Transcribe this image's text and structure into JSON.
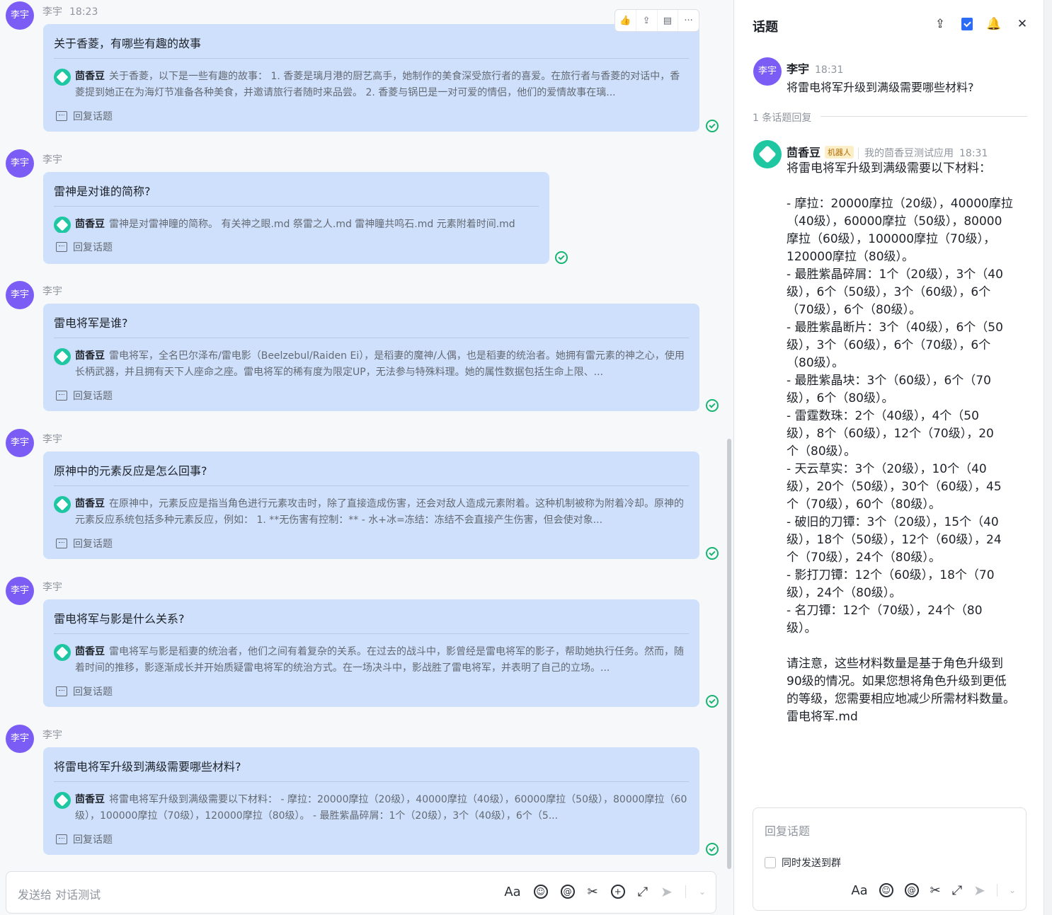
{
  "toolbar": {
    "like": "👍",
    "share": "⇪",
    "card": "▤",
    "more": "···"
  },
  "messages": [
    {
      "avatar": "李宇",
      "user": "李宇",
      "time": "18:23",
      "question": "关于香菱，有哪些有趣的故事",
      "bot": "茴香豆",
      "answer": "关于香菱，以下是一些有趣的故事： 1. 香菱是璃月港的厨艺高手，她制作的美食深受旅行者的喜爱。在旅行者与香菱的对话中，香菱提到她正在为海灯节准备各种美食，并邀请旅行者随时来品尝。 2. 香菱与锅巴是一对可爱的情侣，他们的爱情故事在璃...",
      "reply": "回复话题"
    },
    {
      "avatar": "李宇",
      "user": "李宇",
      "time": "",
      "question": "雷神是对谁的简称?",
      "bot": "茴香豆",
      "answer": "雷神是对雷神瞳的简称。 有关神之眼.md 祭雷之人.md 雷神瞳共鸣石.md 元素附着时间.md",
      "reply": "回复话题"
    },
    {
      "avatar": "李宇",
      "user": "李宇",
      "time": "",
      "question": "雷电将军是谁?",
      "bot": "茴香豆",
      "answer": "雷电将军，全名巴尔泽布/雷电影（Beelzebul/Raiden Ei），是稻妻的魔神/人偶，也是稻妻的统治者。她拥有雷元素的神之心，使用长柄武器，并且拥有天下人座命之座。雷电将军的稀有度为限定UP，无法参与特殊料理。她的属性数据包括生命上限、...",
      "reply": "回复话题"
    },
    {
      "avatar": "李宇",
      "user": "李宇",
      "time": "",
      "question": "原神中的元素反应是怎么回事?",
      "bot": "茴香豆",
      "answer": "在原神中，元素反应是指当角色进行元素攻击时，除了直接造成伤害，还会对敌人造成元素附着。这种机制被称为附着冷却。原神的元素反应系统包括多种元素反应，例如： 1. **无伤害有控制：** - 水+冰=冻结：冻结不会直接产生伤害，但会使对象...",
      "reply": "回复话题"
    },
    {
      "avatar": "李宇",
      "user": "李宇",
      "time": "",
      "question": "雷电将军与影是什么关系?",
      "bot": "茴香豆",
      "answer": "雷电将军与影是稻妻的统治者，他们之间有着复杂的关系。在过去的战斗中，影曾经是雷电将军的影子，帮助她执行任务。然而，随着时间的推移，影逐渐成长并开始质疑雷电将军的统治方式。在一场决斗中，影战胜了雷电将军，并表明了自己的立场。...",
      "reply": "回复话题"
    },
    {
      "avatar": "李宇",
      "user": "李宇",
      "time": "",
      "question": "将雷电将军升级到满级需要哪些材料?",
      "bot": "茴香豆",
      "answer": "将雷电将军升级到满级需要以下材料： - 摩拉：20000摩拉（20级），40000摩拉（40级），60000摩拉（50级），80000摩拉（60级），100000摩拉（70级），120000摩拉（80级）。 - 最胜紫晶碎屑：1个（20级），3个（40级），6个（5...",
      "reply": "回复话题"
    }
  ],
  "composer": {
    "placeholder": "发送给 对话测试",
    "font": "Aa",
    "emoji": "☺",
    "mention": "@",
    "scissors": "✂",
    "plus": "+",
    "expand": "⤢",
    "send": "➤",
    "dropdown": "⌄"
  },
  "panel": {
    "title": "话题",
    "icons": {
      "share": "⇪",
      "bell": "🔔",
      "close": "✕"
    },
    "user_avatar": "李宇",
    "user": "李宇",
    "user_time": "18:31",
    "question": "将雷电将军升级到满级需要哪些材料?",
    "reply_count": "1 条话题回复",
    "bot": "茴香豆",
    "bot_tag": "机器人",
    "bot_app": "我的茴香豆测试应用",
    "bot_time": "18:31",
    "bot_body": "将雷电将军升级到满级需要以下材料：\n\n- 摩拉：20000摩拉（20级），40000摩拉\n（40级），60000摩拉（50级），80000\n摩拉（60级），100000摩拉（70级），\n120000摩拉（80级）。\n- 最胜紫晶碎屑：1个（20级），3个（40\n级），6个（50级），3个（60级），6个\n（70级），6个（80级）。\n- 最胜紫晶断片：3个（40级），6个（50\n级），3个（60级），6个（70级），6个\n（80级）。\n- 最胜紫晶块：3个（60级），6个（70\n级），6个（80级）。\n- 雷霆数珠：2个（40级），4个（50\n级），8个（60级），12个（70级），20\n个（80级）。\n- 天云草实：3个（20级），10个（40\n级），20个（50级），30个（60级），45\n个（70级），60个（80级）。\n- 破旧的刀镡：3个（20级），15个（40\n级），18个（50级），12个（60级），24\n个（70级），24个（80级）。\n- 影打刀镡：12个（60级），18个（70\n级），24个（80级）。\n- 名刀镡：12个（70级），24个（80\n级）。\n\n请注意，这些材料数量是基于角色升级到\n90级的情况。如果您想将角色升级到更低\n的等级，您需要相应地减少所需材料数量。\n雷电将军.md",
    "reply_placeholder": "回复话题",
    "also_send": "同时发送到群"
  }
}
